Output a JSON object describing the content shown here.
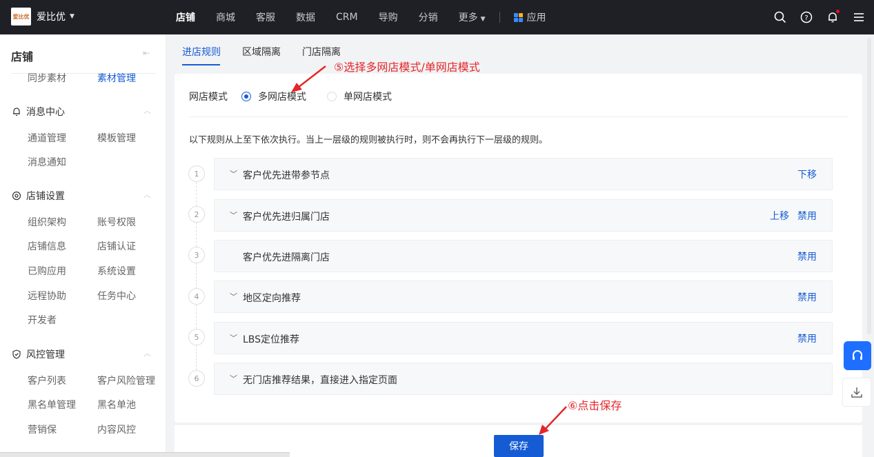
{
  "topbar": {
    "brand_logo_text": "爱比优",
    "brand_name": "爱比优",
    "nav": [
      {
        "label": "店铺",
        "active": true
      },
      {
        "label": "商城"
      },
      {
        "label": "客服"
      },
      {
        "label": "数据"
      },
      {
        "label": "CRM"
      },
      {
        "label": "导购"
      },
      {
        "label": "分销"
      },
      {
        "label": "更多"
      }
    ],
    "app_label": "应用",
    "icons": [
      "search-icon",
      "help-icon",
      "bell-icon",
      "menu-icon"
    ]
  },
  "sidebar": {
    "title": "店铺",
    "top_links": [
      {
        "label": "同步素材"
      },
      {
        "label": "素材管理",
        "active": true
      }
    ],
    "sections": [
      {
        "title": "消息中心",
        "icon": "bell-icon",
        "items": [
          "通道管理",
          "模板管理",
          "消息通知"
        ]
      },
      {
        "title": "店铺设置",
        "icon": "gear-icon",
        "items": [
          "组织架构",
          "账号权限",
          "店铺信息",
          "店铺认证",
          "已购应用",
          "系统设置",
          "远程协助",
          "任务中心",
          "开发者"
        ]
      },
      {
        "title": "风控管理",
        "icon": "shield-icon",
        "items": [
          "客户列表",
          "客户风险管理",
          "黑名单管理",
          "黑名单池",
          "营销保",
          "内容风控"
        ]
      }
    ]
  },
  "tabs": [
    {
      "label": "进店规则",
      "active": true
    },
    {
      "label": "区域隔离"
    },
    {
      "label": "门店隔离"
    }
  ],
  "store_mode": {
    "label": "网店模式",
    "options": [
      {
        "label": "多网店模式",
        "checked": true
      },
      {
        "label": "单网店模式",
        "checked": false
      }
    ]
  },
  "description": "以下规则从上至下依次执行。当上一层级的规则被执行时，则不会再执行下一层级的规则。",
  "rules": [
    {
      "num": "1",
      "title": "客户优先进带参节点",
      "expandable": true,
      "actions": [
        "下移"
      ]
    },
    {
      "num": "2",
      "title": "客户优先进归属门店",
      "expandable": true,
      "actions": [
        "上移",
        "禁用"
      ]
    },
    {
      "num": "3",
      "title": "客户优先进隔离门店",
      "expandable": false,
      "actions": [
        "禁用"
      ]
    },
    {
      "num": "4",
      "title": "地区定向推荐",
      "expandable": true,
      "actions": [
        "禁用"
      ]
    },
    {
      "num": "5",
      "title": "LBS定位推荐",
      "expandable": true,
      "actions": [
        "禁用"
      ]
    },
    {
      "num": "6",
      "title": "无门店推荐结果，直接进入指定页面",
      "expandable": true,
      "actions": []
    }
  ],
  "save_label": "保存",
  "annotations": {
    "step5": "⑤选择多网店模式/单网店模式",
    "step6": "⑥点击保存",
    "color": "#e3262a"
  },
  "colors": {
    "primary": "#155bd4",
    "topbar": "#1f2026"
  }
}
